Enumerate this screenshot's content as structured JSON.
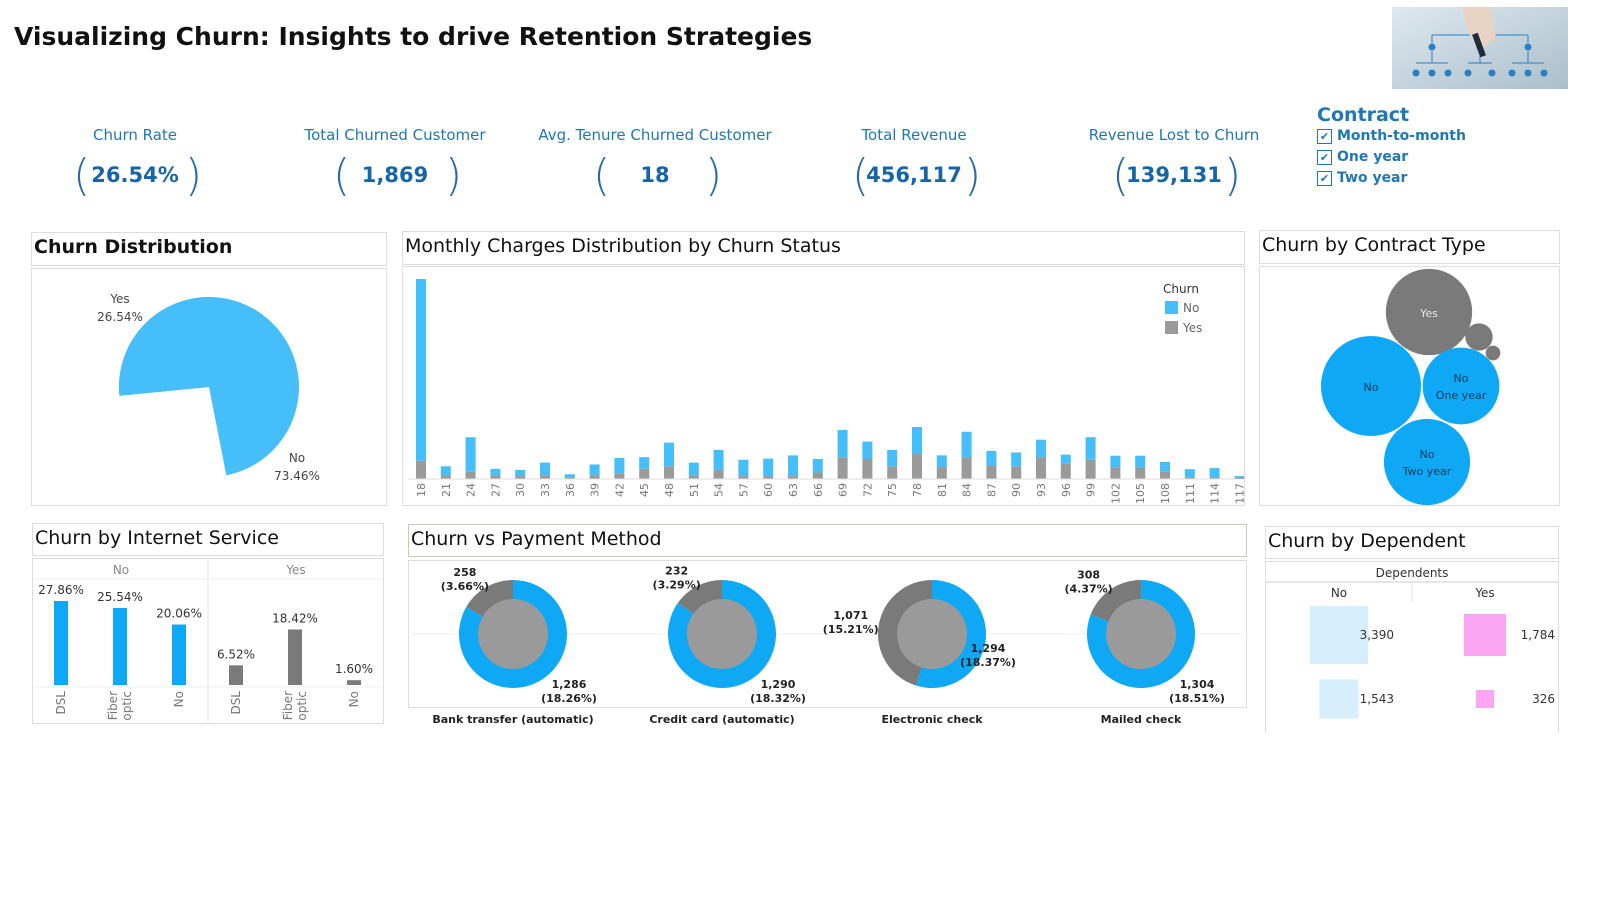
{
  "header": {
    "title": "Visualizing Churn: Insights to drive Retention Strategies"
  },
  "kpis": [
    {
      "label": "Churn Rate",
      "value": "26.54%"
    },
    {
      "label": "Total Churned Customer",
      "value": "1,869"
    },
    {
      "label": "Avg. Tenure Churned Customer",
      "value": "18"
    },
    {
      "label": "Total Revenue",
      "value": "456,117"
    },
    {
      "label": "Revenue Lost to Churn",
      "value": "139,131"
    }
  ],
  "filter": {
    "title": "Contract",
    "items": [
      {
        "label": "Month-to-month",
        "checked": true
      },
      {
        "label": "One year",
        "checked": true
      },
      {
        "label": "Two year",
        "checked": true
      }
    ]
  },
  "colors": {
    "no": "#45befa",
    "yes": "#9a9a9a",
    "yes_dark": "#7a7a7a",
    "accent": "#1f77b4",
    "pink": "#fba6f3",
    "light_blue": "#d6eefc"
  },
  "panels": {
    "churn_distribution": "Churn Distribution",
    "monthly_charges": "Monthly Charges Distribution by Churn Status",
    "contract_type": "Churn by Contract Type",
    "internet_service": "Churn by Internet Service",
    "payment_method": "Churn vs Payment Method",
    "dependent": "Churn by Dependent"
  },
  "chart_data": [
    {
      "id": "pie",
      "type": "pie",
      "slices": [
        {
          "label": "Yes",
          "pct_label": "26.54%",
          "value": 26.54
        },
        {
          "label": "No",
          "pct_label": "73.46%",
          "value": 73.46
        }
      ]
    },
    {
      "id": "histogram",
      "type": "bar",
      "legend_title": "Churn",
      "legend": [
        "No",
        "Yes"
      ],
      "categories": [
        "18",
        "21",
        "24",
        "27",
        "30",
        "33",
        "36",
        "39",
        "42",
        "45",
        "48",
        "51",
        "54",
        "57",
        "60",
        "63",
        "66",
        "69",
        "72",
        "75",
        "78",
        "81",
        "84",
        "87",
        "90",
        "93",
        "96",
        "99",
        "102",
        "105",
        "108",
        "111",
        "114",
        "117"
      ],
      "series": [
        {
          "name": "No",
          "values": [
            500,
            25,
            95,
            18,
            17,
            35,
            8,
            30,
            42,
            32,
            65,
            35,
            55,
            45,
            48,
            57,
            37,
            75,
            48,
            45,
            73,
            32,
            70,
            40,
            38,
            48,
            25,
            62,
            32,
            32,
            27,
            22,
            25,
            5
          ]
        },
        {
          "name": "Yes",
          "values": [
            50,
            10,
            20,
            10,
            8,
            10,
            5,
            10,
            16,
            28,
            35,
            10,
            25,
            8,
            8,
            8,
            18,
            60,
            55,
            35,
            70,
            33,
            60,
            37,
            35,
            60,
            42,
            53,
            32,
            32,
            20,
            5,
            5,
            3
          ]
        }
      ]
    },
    {
      "id": "contract_bubbles",
      "type": "bubble",
      "bubbles": [
        {
          "label": "Yes",
          "sub": "",
          "group": "Yes",
          "value": 1655
        },
        {
          "label": "No",
          "sub": "",
          "group": "No",
          "value": 2220
        },
        {
          "label": "No",
          "sub": "One year",
          "group": "No",
          "value": 1307
        },
        {
          "label": "No",
          "sub": "Two year",
          "group": "No",
          "value": 1647
        },
        {
          "label": "",
          "sub": "",
          "group": "Yes",
          "value": 166
        },
        {
          "label": "",
          "sub": "",
          "group": "Yes",
          "value": 48
        }
      ]
    },
    {
      "id": "internet",
      "type": "bar",
      "panels": [
        "No",
        "Yes"
      ],
      "categories": [
        "DSL",
        "Fiber optic",
        "No"
      ],
      "series": [
        {
          "name": "No",
          "values": [
            27.86,
            25.54,
            20.06
          ],
          "labels": [
            "27.86%",
            "25.54%",
            "20.06%"
          ]
        },
        {
          "name": "Yes",
          "values": [
            6.52,
            18.42,
            1.6
          ],
          "labels": [
            "6.52%",
            "18.42%",
            "1.60%"
          ]
        }
      ]
    },
    {
      "id": "payment",
      "type": "pie",
      "methods": [
        {
          "name": "Bank transfer (automatic)",
          "yes": 258,
          "yes_label": "258",
          "yes_pct": "(3.66%)",
          "no": 1286,
          "no_label": "1,286",
          "no_pct": "(18.26%)"
        },
        {
          "name": "Credit card (automatic)",
          "yes": 232,
          "yes_label": "232",
          "yes_pct": "(3.29%)",
          "no": 1290,
          "no_label": "1,290",
          "no_pct": "(18.32%)"
        },
        {
          "name": "Electronic check",
          "yes": 1071,
          "yes_label": "1,071",
          "yes_pct": "(15.21%)",
          "no": 1294,
          "no_label": "1,294",
          "no_pct": "(18.37%)"
        },
        {
          "name": "Mailed check",
          "yes": 308,
          "yes_label": "308",
          "yes_pct": "(4.37%)",
          "no": 1304,
          "no_label": "1,304",
          "no_pct": "(18.51%)"
        }
      ]
    },
    {
      "id": "dependent",
      "type": "table",
      "header": "Dependents",
      "columns": [
        "No",
        "Yes"
      ],
      "rows": [
        {
          "values": [
            3390,
            1784
          ],
          "labels": [
            "3,390",
            "1,784"
          ]
        },
        {
          "values": [
            1543,
            326
          ],
          "labels": [
            "1,543",
            "326"
          ]
        }
      ]
    }
  ]
}
